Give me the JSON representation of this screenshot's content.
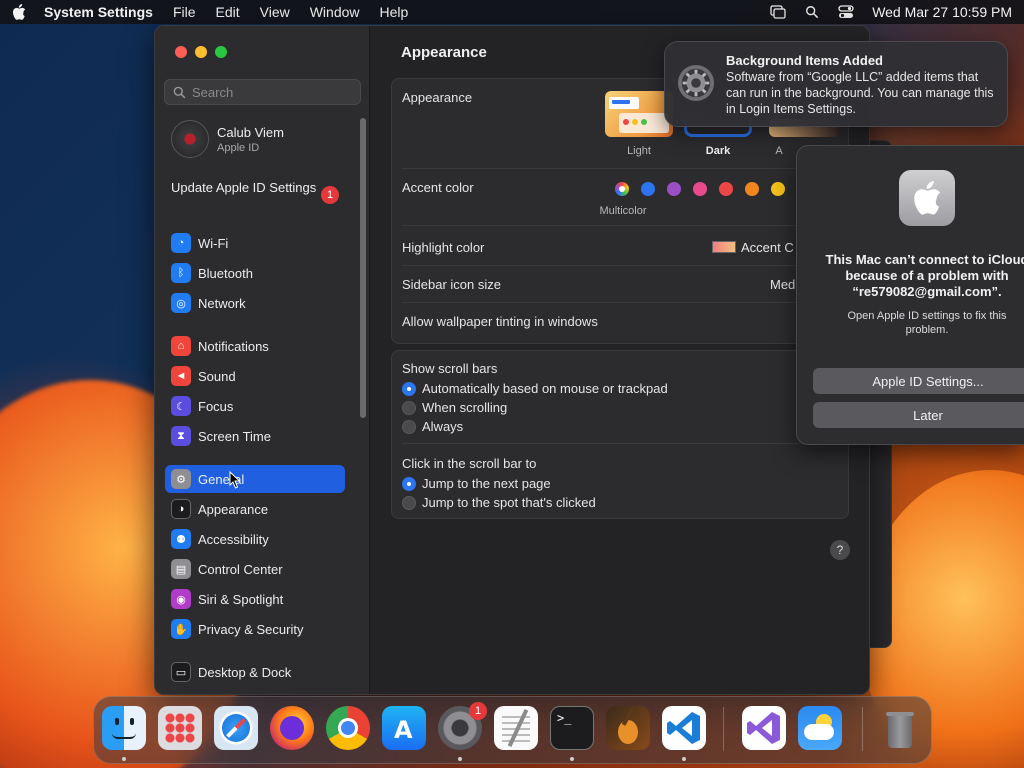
{
  "menubar": {
    "app_name": "System Settings",
    "items": [
      "File",
      "Edit",
      "View",
      "Window",
      "Help"
    ],
    "datetime": "Wed Mar 27  10:59 PM"
  },
  "sidebar": {
    "search_placeholder": "Search",
    "profile": {
      "name": "Calub Viem",
      "subtitle": "Apple ID"
    },
    "update": {
      "label": "Update Apple ID Settings",
      "badge": "1"
    },
    "items": [
      {
        "label": "Wi-Fi",
        "icon": "wifi-icon",
        "color": "#1f7cf2"
      },
      {
        "label": "Bluetooth",
        "icon": "bluetooth-icon",
        "color": "#1f7cf2"
      },
      {
        "label": "Network",
        "icon": "globe-icon",
        "color": "#1f7cf2"
      },
      {
        "label": "Notifications",
        "icon": "bell-icon",
        "color": "#f0453a"
      },
      {
        "label": "Sound",
        "icon": "speaker-icon",
        "color": "#f0453a"
      },
      {
        "label": "Focus",
        "icon": "moon-icon",
        "color": "#5a4de0"
      },
      {
        "label": "Screen Time",
        "icon": "hourglass-icon",
        "color": "#5a4de0"
      },
      {
        "label": "General",
        "icon": "gear-icon",
        "color": "#8e8e93"
      },
      {
        "label": "Appearance",
        "icon": "appearance-icon",
        "color": "#1c1c1e"
      },
      {
        "label": "Accessibility",
        "icon": "accessibility-icon",
        "color": "#1f7cf2"
      },
      {
        "label": "Control Center",
        "icon": "control-center-icon",
        "color": "#8e8e93"
      },
      {
        "label": "Siri & Spotlight",
        "icon": "siri-icon",
        "color": "#b03cc8"
      },
      {
        "label": "Privacy & Security",
        "icon": "hand-icon",
        "color": "#1f7cf2"
      },
      {
        "label": "Desktop & Dock",
        "icon": "dock-icon",
        "color": "#1c1c1e"
      }
    ],
    "selected": "General"
  },
  "content": {
    "title": "Appearance",
    "appearance": {
      "label": "Appearance",
      "options": [
        "Light",
        "Dark",
        "A"
      ],
      "selected": "Dark"
    },
    "accent": {
      "label": "Accent color",
      "selected_name": "Multicolor",
      "colors": [
        "#2c74f0",
        "#9b4fc4",
        "#e84a8c",
        "#ec4646",
        "#f0861e",
        "#f5c21b"
      ]
    },
    "highlight": {
      "label": "Highlight color",
      "value": "Accent C"
    },
    "sidebar_icon": {
      "label": "Sidebar icon size",
      "value": "Med"
    },
    "tinting": {
      "label": "Allow wallpaper tinting in windows"
    },
    "scroll_bars": {
      "label": "Show scroll bars",
      "options": [
        "Automatically based on mouse or trackpad",
        "When scrolling",
        "Always"
      ],
      "selected": 0
    },
    "click_scroll": {
      "label": "Click in the scroll bar to",
      "options": [
        "Jump to the next page",
        "Jump to the spot that's clicked"
      ],
      "selected": 0
    },
    "help": "?"
  },
  "notification": {
    "title": "Background Items Added",
    "body": "Software from “Google LLC” added items that can run in the background. You can manage this in Login Items Settings."
  },
  "dialog": {
    "title": "This Mac can’t connect to iCloud because of a problem with “re579082@gmail.com”.",
    "message": "Open Apple ID settings to fix this problem.",
    "primary_button": "Apple ID Settings...",
    "secondary_button": "Later"
  },
  "dock": {
    "apps": [
      "finder-icon",
      "launchpad-icon",
      "safari-icon",
      "firefox-icon",
      "chrome-icon",
      "app-store-icon",
      "system-settings-icon",
      "textedit-icon",
      "terminal-icon",
      "garageband-icon",
      "vscode-icon",
      "visual-studio-icon",
      "weather-icon",
      "trash-icon"
    ],
    "settings_badge": "1"
  }
}
